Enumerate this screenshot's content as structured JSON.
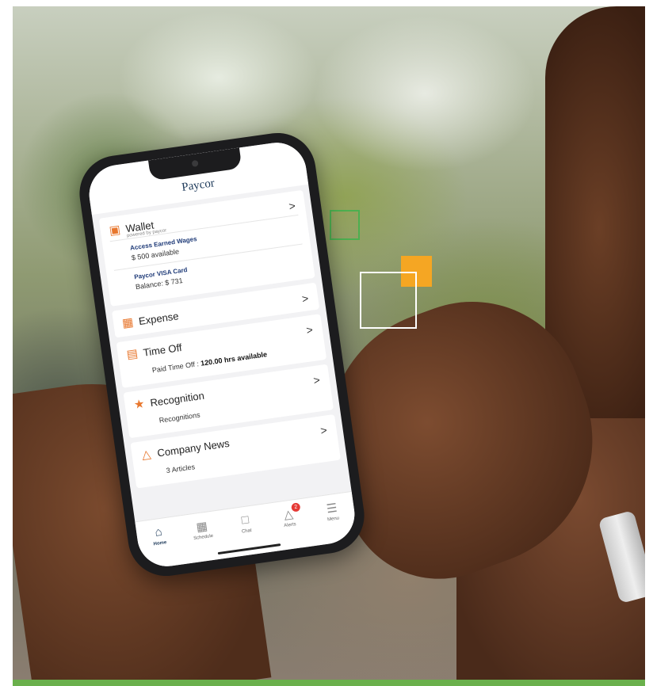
{
  "app": {
    "brand": "Paycor"
  },
  "wallet": {
    "title": "Wallet",
    "powered_by": "powered by paycor",
    "chevron": ">",
    "items": [
      {
        "title": "Access Earned Wages",
        "value": "$ 500 available"
      },
      {
        "title": "Paycor VISA Card",
        "value": "Balance: $ 731"
      }
    ]
  },
  "expense": {
    "title": "Expense",
    "chevron": ">"
  },
  "time_off": {
    "title": "Time Off",
    "chevron": ">",
    "detail_label": "Paid Time Off :",
    "detail_value": "120.00 hrs available"
  },
  "recognition": {
    "title": "Recognition",
    "chevron": ">",
    "detail": "Recognitions"
  },
  "company_news": {
    "title": "Company News",
    "chevron": ">",
    "detail": "3 Articles"
  },
  "tabbar": {
    "items": [
      {
        "label": "Home",
        "icon": "home-icon",
        "active": true
      },
      {
        "label": "Schedule",
        "icon": "calendar-icon"
      },
      {
        "label": "Chat",
        "icon": "chat-icon"
      },
      {
        "label": "Alerts",
        "icon": "bell-icon",
        "badge": "2"
      },
      {
        "label": "Menu",
        "icon": "menu-icon"
      }
    ]
  },
  "colors": {
    "accent_orange": "#f5a623",
    "accent_green": "#6ab04c",
    "icon_orange": "#e8772e",
    "brand_navy": "#1f3b5b",
    "badge_red": "#e53935"
  }
}
